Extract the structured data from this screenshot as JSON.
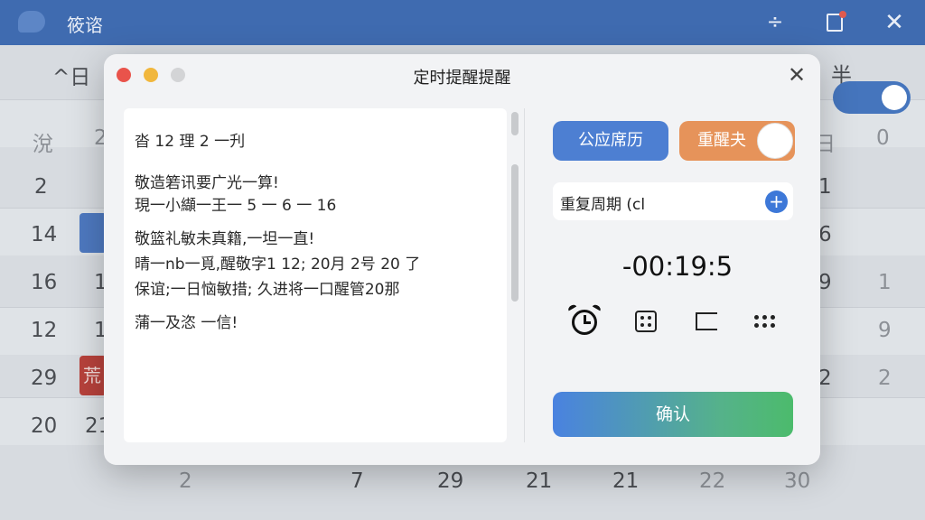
{
  "app": {
    "title": "筱谘"
  },
  "calendar": {
    "header_left": "^日",
    "header_right": "半",
    "weekday_left": "涗",
    "weekday_left2": "2",
    "weekday_right": "日",
    "weekday_right2": "0",
    "left_col": [
      "2",
      "14",
      "16",
      "12",
      "29",
      "20"
    ],
    "left_col2": [
      "",
      "",
      "1",
      "1",
      "",
      "21"
    ],
    "right_col": [
      "1",
      "6",
      "9",
      "",
      "2",
      ""
    ],
    "right_col2": [
      "",
      "",
      "1",
      "9",
      "2",
      ""
    ],
    "bottom_row": [
      "2",
      "7",
      "29",
      "21",
      "21",
      "22",
      "30"
    ],
    "red_label": "荒"
  },
  "dialog": {
    "title": "定时提醒提醒",
    "note_lines": [
      "沓 12  理 2 一刋",
      "敬造箬讯要广光一算!",
      "現一小纈一王一 5  一 6  一 16",
      "敬篮礼敏未真籍,一坦一直!",
      "晴一nb一覓,醒敬字1 12;  20月 2号 20 了",
      "保谊;一日恼敏措;  久进将一口醒管20那",
      "蒲一及恣 一信!"
    ],
    "solar_button": "公应席历",
    "remind_button": "重醒夬",
    "repeat_label": "重复周期 (cl",
    "countdown": "-00:19:5",
    "confirm_button": "确认"
  },
  "icons": {
    "close": "close-icon",
    "alarm": "alarm-clock-icon",
    "dice": "dice-icon",
    "bracket": "bracket-icon",
    "dots": "grid-dots-icon",
    "add": "plus-icon"
  },
  "colors": {
    "titlebar": "#3f6bb0",
    "solar_button": "#4d7fd2",
    "remind_button": "#e6935a",
    "confirm_start": "#4a82e0",
    "confirm_end": "#4cbb6c"
  }
}
